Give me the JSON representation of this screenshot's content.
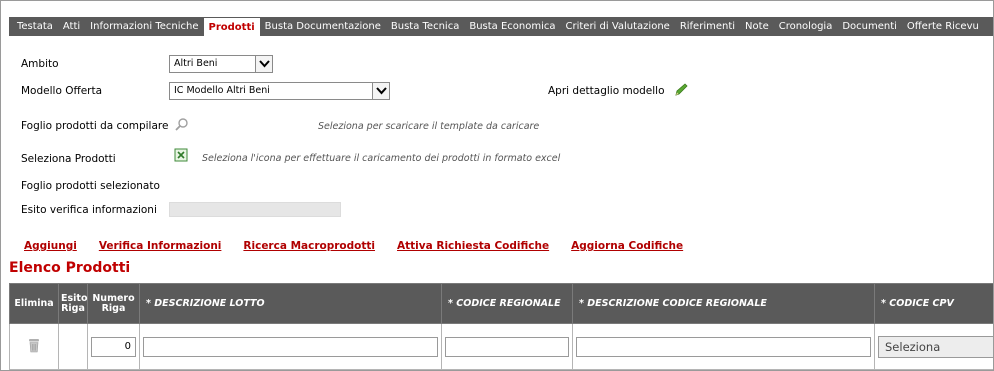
{
  "tabs": [
    {
      "label": "Testata"
    },
    {
      "label": "Atti"
    },
    {
      "label": "Informazioni Tecniche"
    },
    {
      "label": "Prodotti"
    },
    {
      "label": "Busta Documentazione"
    },
    {
      "label": "Busta Tecnica"
    },
    {
      "label": "Busta Economica"
    },
    {
      "label": "Criteri di Valutazione"
    },
    {
      "label": "Riferimenti"
    },
    {
      "label": "Note"
    },
    {
      "label": "Cronologia"
    },
    {
      "label": "Documenti"
    },
    {
      "label": "Offerte Ricevu"
    }
  ],
  "active_tab": "Prodotti",
  "form": {
    "ambito_label": "Ambito",
    "ambito_value": "Altri Beni",
    "modello_label": "Modello Offerta",
    "modello_value": "IC Modello Altri Beni",
    "apri_dettaglio_label": "Apri dettaglio modello",
    "foglio_label": "Foglio prodotti da compilare",
    "foglio_hint": "Seleziona per scaricare il template da caricare",
    "seleziona_label": "Seleziona Prodotti",
    "seleziona_hint": "Seleziona l'icona per effettuare il caricamento dei prodotti in formato excel",
    "foglio_sel_label": "Foglio prodotti selezionato",
    "esito_label": "Esito verifica informazioni",
    "esito_value": ""
  },
  "actions": {
    "aggiungi": "Aggiungi",
    "verifica": "Verifica Informazioni",
    "ricerca": "Ricerca Macroprodotti",
    "attiva": "Attiva Richiesta Codifiche",
    "aggiorna": "Aggiorna Codifiche"
  },
  "section_title": "Elenco Prodotti",
  "table": {
    "headers": {
      "elimina": "Elimina",
      "esito_1": "Esito",
      "esito_2": "Riga",
      "numero_1": "Numero",
      "numero_2": "Riga",
      "descrizione_lotto": "* DESCRIZIONE LOTTO",
      "codice_regionale": "* CODICE REGIONALE",
      "descrizione_codice": "* DESCRIZIONE CODICE REGIONALE",
      "codice_cpv": "* CODICE CPV"
    },
    "row": {
      "numero_riga": "0",
      "descrizione_lotto": "",
      "codice_regionale": "",
      "descrizione_codice": "",
      "codice_cpv": "Seleziona"
    }
  },
  "colors": {
    "tab_bg": "#5a5a5a",
    "accent_red": "#c00000",
    "link_red": "#b00000"
  }
}
